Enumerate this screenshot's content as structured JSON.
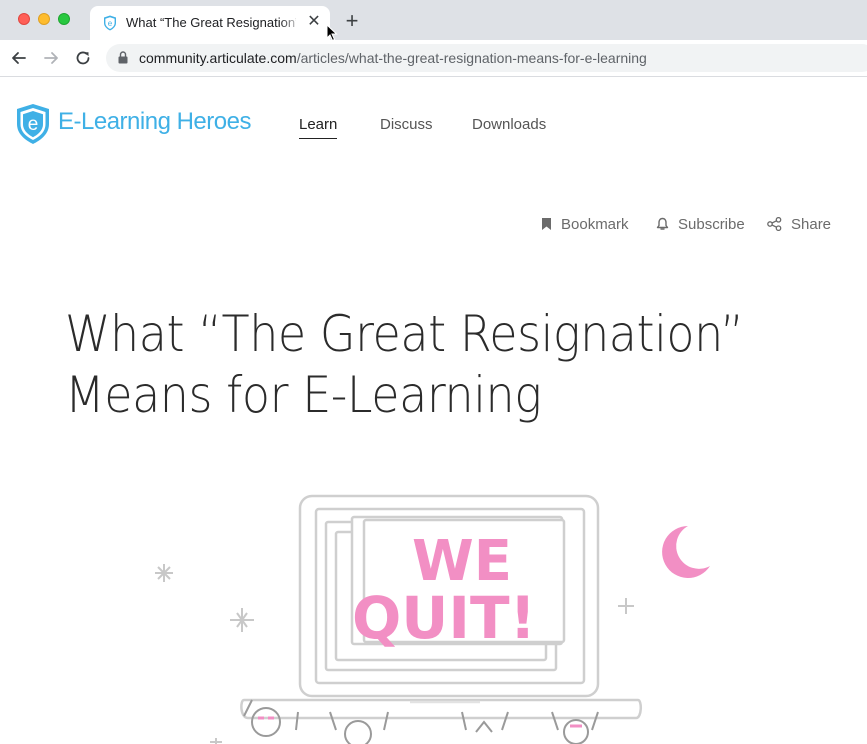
{
  "browser": {
    "tab_title": "What “The Great Resignation” Means for E-Learning",
    "tab_close": "✕",
    "new_tab": "+",
    "url_domain": "community.articulate.com",
    "url_path": "/articles/what-the-great-resignation-means-for-e-learning"
  },
  "site": {
    "logo_text": "E-Learning Heroes",
    "logo_letter": "e",
    "nav": [
      {
        "label": "Learn",
        "active": true
      },
      {
        "label": "Discuss",
        "active": false
      },
      {
        "label": "Downloads",
        "active": false
      }
    ]
  },
  "actions": {
    "bookmark": "Bookmark",
    "subscribe": "Subscribe",
    "share": "Share"
  },
  "article": {
    "title": "What “The Great Resignation” Means for E-Learning",
    "hero_text_line1": "WE",
    "hero_text_line2": "QUIT!"
  },
  "colors": {
    "brand": "#3fb0e6",
    "hero_pink": "#f28fc4"
  }
}
